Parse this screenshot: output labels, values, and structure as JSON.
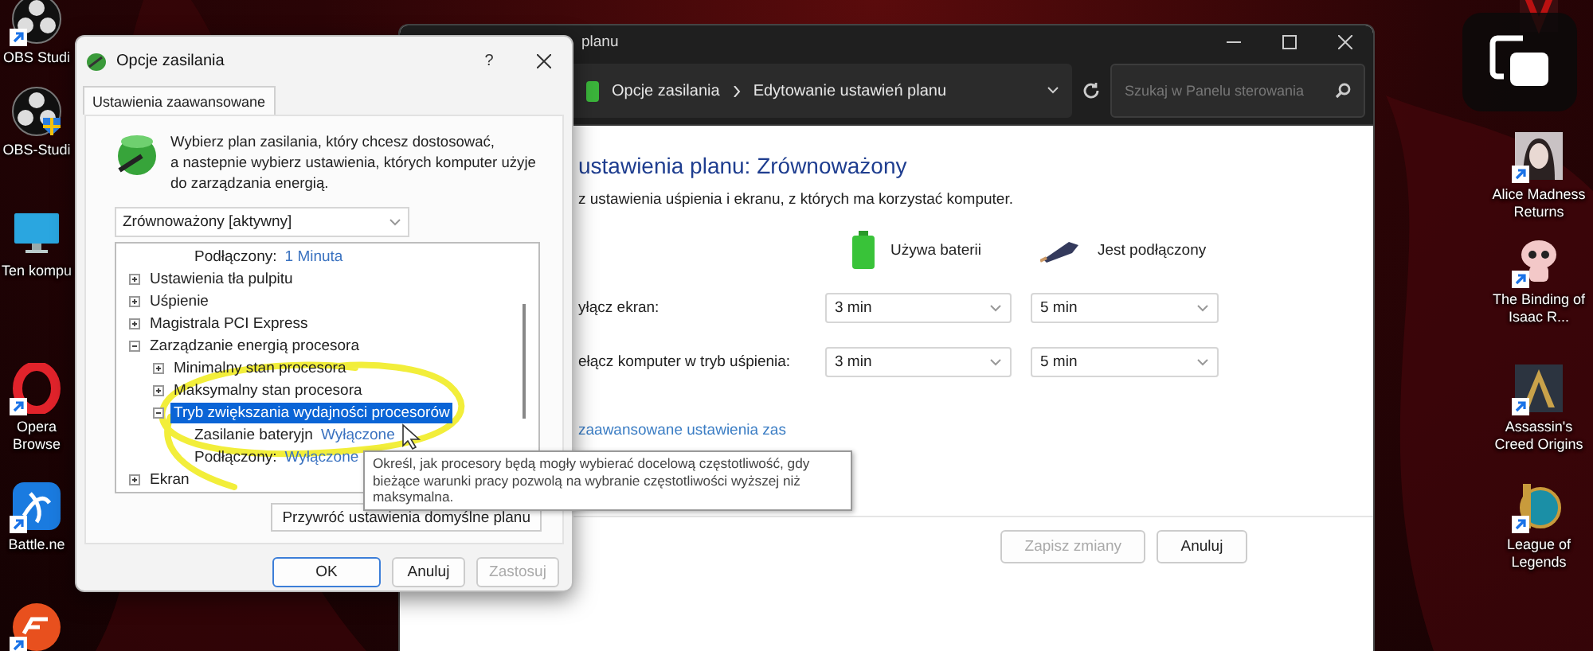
{
  "desktop": {
    "left_icons": [
      {
        "kind": "obs",
        "label": "OBS Studi",
        "shortcut": true
      },
      {
        "kind": "obsadmin",
        "label": "OBS-Studi",
        "shortcut": false
      },
      {
        "kind": "monitor",
        "label": "Ten kompu",
        "shortcut": false
      },
      {
        "kind": "opera",
        "label": "Opera Browse",
        "shortcut": true
      },
      {
        "kind": "battle",
        "label": "Battle.ne",
        "shortcut": true
      },
      {
        "kind": "ea",
        "shortcut": true
      }
    ],
    "right_icons": [
      {
        "kind": "diablo",
        "shortcut": false
      },
      {
        "kind": "alice",
        "label": "Alice Madness Returns",
        "shortcut": true
      },
      {
        "kind": "isaac",
        "label": "The Binding of Isaac R...",
        "shortcut": true
      },
      {
        "kind": "assassin",
        "label": "Assassin's Creed Origins",
        "shortcut": true
      },
      {
        "kind": "league",
        "label": "League of Legends",
        "shortcut": true
      }
    ]
  },
  "control_panel": {
    "title": "planu",
    "breadcrumb": [
      "Opcje zasilania",
      "Edytowanie ustawień planu"
    ],
    "search": {
      "placeholder": "Szukaj w Panelu sterowania"
    },
    "heading": "ustawienia planu: Zrównoważony",
    "description": "z ustawienia uśpienia i ekranu, z których ma korzystać komputer.",
    "columns": [
      {
        "kind": "battery",
        "label": "Używa baterii"
      },
      {
        "kind": "plug",
        "label": "Jest podłączony"
      }
    ],
    "rows": [
      {
        "label": "yłącz ekran:",
        "values": [
          "3 min",
          "5 min"
        ]
      },
      {
        "label": "ełącz komputer w tryb uśpienia:",
        "values": [
          "3 min",
          "5 min"
        ]
      }
    ],
    "link": "zaawansowane ustawienia zas",
    "buttons": [
      {
        "label": "Zapisz zmiany",
        "disabled": true
      },
      {
        "label": "Anuluj",
        "disabled": false
      }
    ]
  },
  "dialog": {
    "title": "Opcje zasilania",
    "help": "?",
    "tabs": [
      {
        "label": "Ustawienia zaawansowane",
        "selected": true
      }
    ],
    "intro": [
      "Wybierz plan zasilania, który chcesz dostosować,",
      "a nastepnie wybierz ustawienia, których komputer użyje",
      "do zarządzania energią."
    ],
    "plan": "Zrównoważony [aktywny]",
    "tree": [
      {
        "kind": "value",
        "label": "Podłączony:",
        "value": "1 Minuta"
      },
      {
        "kind": "group",
        "label": "Ustawienia tła pulpitu",
        "expanded": false,
        "selected": false
      },
      {
        "kind": "group",
        "label": "Uśpienie",
        "expanded": false,
        "selected": false
      },
      {
        "kind": "group",
        "label": "Magistrala PCI Express",
        "expanded": false,
        "selected": false
      },
      {
        "kind": "group",
        "label": "Zarządzanie energią procesora",
        "expanded": true,
        "selected": false,
        "children": [
          {
            "kind": "group",
            "label": "Minimalny stan procesora",
            "expanded": false,
            "selected": false
          },
          {
            "kind": "group",
            "label": "Maksymalny stan procesora",
            "expanded": false,
            "selected": false
          },
          {
            "kind": "group",
            "label": "Tryb zwiększania wydajności procesorów",
            "expanded": true,
            "selected": true,
            "children": [
              {
                "kind": "value",
                "label": "Zasilanie bateryjn",
                "value": "Wyłączone"
              },
              {
                "kind": "value",
                "label": "Podłączony:",
                "value": "Wyłączone"
              }
            ]
          }
        ]
      },
      {
        "kind": "group",
        "label": "Ekran",
        "expanded": false,
        "selected": false
      }
    ],
    "restore_button": "Przywróć ustawienia domyślne planu",
    "buttons": [
      {
        "label": "OK",
        "default": true,
        "disabled": false
      },
      {
        "label": "Anuluj",
        "default": false,
        "disabled": false
      },
      {
        "label": "Zastosuj",
        "default": false,
        "disabled": true
      }
    ]
  },
  "tooltip": "Określ, jak procesory będą mogły wybierać docelową częstotliwość, gdy bieżące warunki pracy pozwolą na wybranie częstotliwości wyższej niż maksymalna."
}
